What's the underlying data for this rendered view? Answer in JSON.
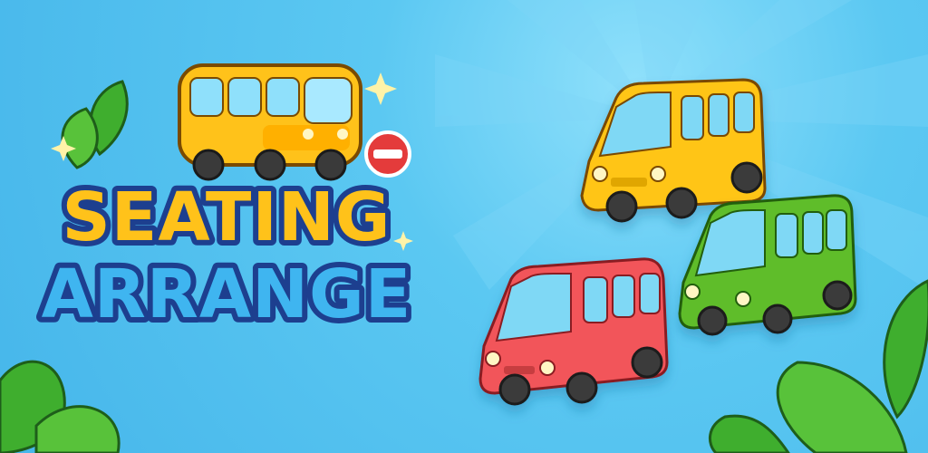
{
  "title": {
    "line1": "SEATING",
    "line2": "ARRANGE"
  },
  "colors": {
    "sky": "#5bc8f2",
    "title_yellow": "#ffc21a",
    "title_blue": "#3fb5f0",
    "title_outline": "#1d3f8f",
    "van_yellow": "#ffc519",
    "van_green": "#5fbd2a",
    "van_red": "#f2555a",
    "leaf_green": "#3fae2e",
    "no_entry_red": "#e43b3b"
  },
  "icons": [
    "bus-icon",
    "no-entry-icon",
    "sparkle-icon",
    "leaf-icon",
    "van-icon"
  ]
}
